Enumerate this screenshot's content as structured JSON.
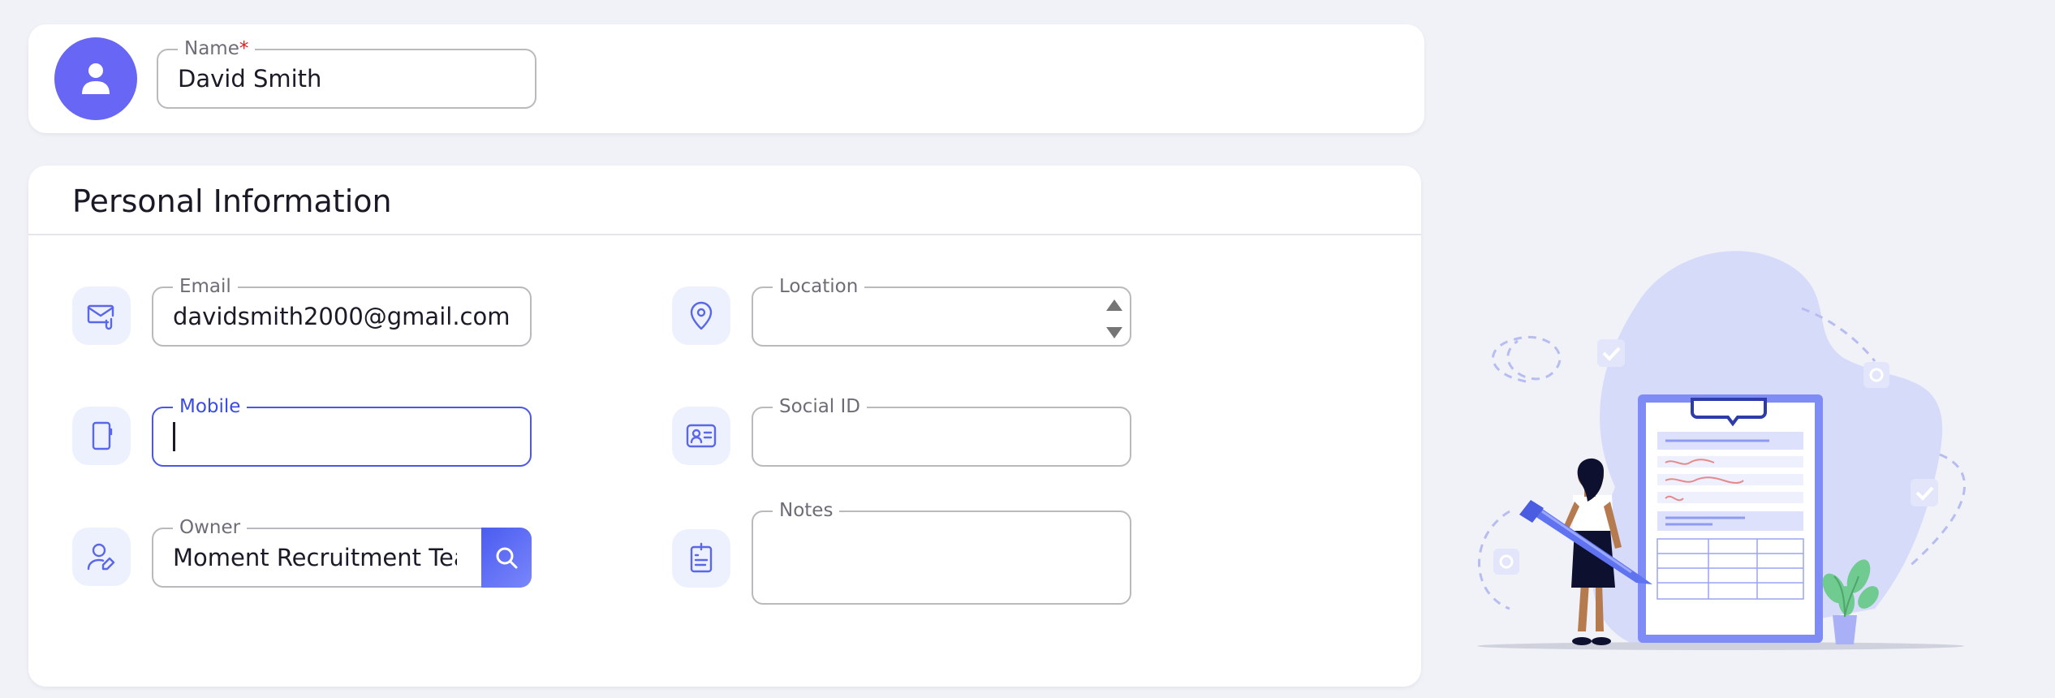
{
  "header": {
    "name_label": "Name",
    "name_required": "*",
    "name_value": "David Smith"
  },
  "personal_info": {
    "title": "Personal Information",
    "email": {
      "label": "Email",
      "value": "davidsmith2000@gmail.com"
    },
    "mobile": {
      "label": "Mobile",
      "value": ""
    },
    "owner": {
      "label": "Owner",
      "value": "Moment Recruitment Team"
    },
    "location": {
      "label": "Location",
      "value": ""
    },
    "social_id": {
      "label": "Social ID",
      "value": ""
    },
    "notes": {
      "label": "Notes",
      "value": ""
    }
  },
  "colors": {
    "accent": "#6766f5",
    "focus": "#4b57e8",
    "icon_bg": "#edf1fe",
    "page_bg": "#f1f2f7"
  },
  "icons": {
    "avatar": "user-icon",
    "email": "mail-attachment-icon",
    "mobile": "phone-icon",
    "owner": "user-edit-icon",
    "location": "map-pin-icon",
    "social_id": "id-card-icon",
    "notes": "clipboard-list-icon",
    "search": "search-icon"
  }
}
